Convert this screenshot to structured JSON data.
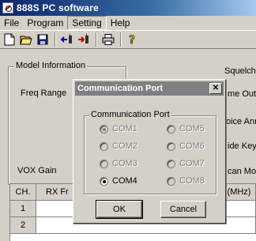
{
  "window": {
    "title": "888S PC software"
  },
  "menu": {
    "items": [
      "File",
      "Program",
      "Setting",
      "Help"
    ],
    "active": "Setting"
  },
  "main": {
    "model_info_legend": "Model Information",
    "freq_range_label": "Freq Range",
    "squelch_label": "Squelch L",
    "time_out_label": "me Out",
    "voice_label": "oice Ann",
    "side_key_label": "ide Key",
    "scan_mode_label": "can Mod",
    "vox_gain_label": "VOX Gain",
    "table": {
      "headers": {
        "ch": "CH.",
        "rx": "RX Fr",
        "mhz": "(MHz)"
      },
      "rows": [
        "1",
        "2"
      ]
    }
  },
  "dialog": {
    "title": "Communication Port",
    "close_symbol": "✕",
    "group_label": "Communication Port",
    "ports": [
      {
        "label": "COM1",
        "selected": true,
        "enabled": false
      },
      {
        "label": "COM2",
        "selected": false,
        "enabled": false
      },
      {
        "label": "COM3",
        "selected": false,
        "enabled": false
      },
      {
        "label": "COM4",
        "selected": true,
        "enabled": true
      },
      {
        "label": "COM5",
        "selected": false,
        "enabled": false
      },
      {
        "label": "COM6",
        "selected": false,
        "enabled": false
      },
      {
        "label": "COM7",
        "selected": false,
        "enabled": false
      },
      {
        "label": "COM8",
        "selected": false,
        "enabled": false
      }
    ],
    "ok_label": "OK",
    "cancel_label": "Cancel"
  },
  "colors": {
    "window_bg": "#d4d0c8",
    "title_active": "#0a246a",
    "title_inactive": "#808080",
    "disabled_text": "#808080"
  }
}
